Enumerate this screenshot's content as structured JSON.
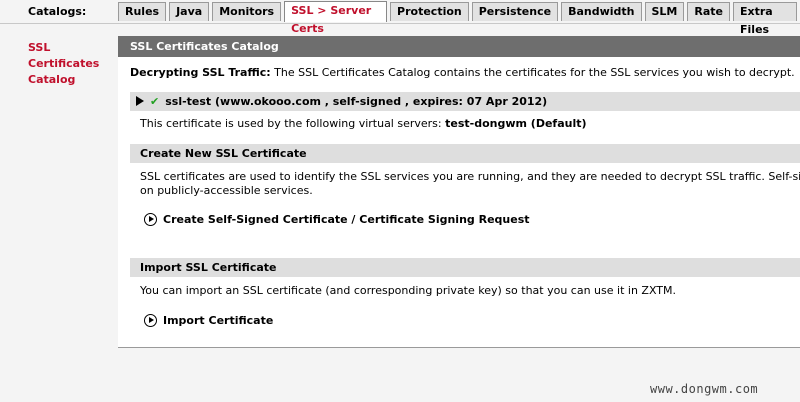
{
  "topbar": {
    "catalogs_label": "Catalogs:",
    "tabs": [
      {
        "label": "Rules",
        "active": false
      },
      {
        "label": "Java",
        "active": false
      },
      {
        "label": "Monitors",
        "active": false
      },
      {
        "label": "SSL > Server Certs",
        "active": true
      },
      {
        "label": "Protection",
        "active": false
      },
      {
        "label": "Persistence",
        "active": false
      },
      {
        "label": "Bandwidth",
        "active": false
      },
      {
        "label": "SLM",
        "active": false
      },
      {
        "label": "Rate",
        "active": false
      },
      {
        "label": "Extra Files",
        "active": false
      }
    ]
  },
  "sidebar": {
    "link_line1": "SSL",
    "link_line2": "Certificates",
    "link_line3": "Catalog"
  },
  "main": {
    "header": "SSL Certificates Catalog",
    "intro_bold": "Decrypting SSL Traffic:",
    "intro_text": " The SSL Certificates Catalog contains the certificates for the SSL services you wish to decrypt.",
    "certificate": {
      "summary": "ssl-test  (www.okooo.com ,  self-signed ,  expires: 07 Apr 2012)",
      "usage_text": "This certificate is used by the following virtual servers: ",
      "usage_servers": "test-dongwm (Default)"
    },
    "create_section": {
      "title": "Create New SSL Certificate",
      "desc_line1": "SSL certificates are used to identify the SSL services you are running, and they are needed to decrypt SSL traffic. Self-signed c",
      "desc_line2": "on publicly-accessible services.",
      "action": "Create Self-Signed Certificate / Certificate Signing Request"
    },
    "import_section": {
      "title": "Import SSL Certificate",
      "desc": "You can import an SSL certificate (and corresponding private key) so that you can use it in ZXTM.",
      "action": "Import Certificate"
    }
  },
  "watermark": "www.dongwm.com",
  "colors": {
    "accent": "#c0102c",
    "header_bg": "#6e6e6e",
    "section_bg": "#dedede",
    "check": "#22a022"
  }
}
